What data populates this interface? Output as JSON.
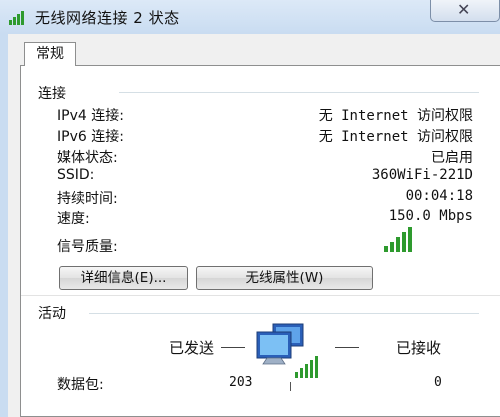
{
  "window": {
    "title": "无线网络连接 2 状态",
    "close_glyph": "✕"
  },
  "tabs": [
    {
      "label": "常规"
    }
  ],
  "connection": {
    "group_label": "连接",
    "rows": [
      {
        "label": "IPv4 连接:",
        "value": "无 Internet 访问权限"
      },
      {
        "label": "IPv6 连接:",
        "value": "无 Internet 访问权限"
      },
      {
        "label": "媒体状态:",
        "value": "已启用"
      },
      {
        "label": "SSID:",
        "value": "360WiFi-221D"
      },
      {
        "label": "持续时间:",
        "value": "00:04:18"
      },
      {
        "label": "速度:",
        "value": "150.0 Mbps"
      }
    ],
    "signal_label": "信号质量:",
    "signal_icon": "signal-bars-icon",
    "signal_level": 1.0,
    "details_button": "详细信息(E)...",
    "properties_button": "无线属性(W)"
  },
  "activity": {
    "group_label": "活动",
    "sent_label": "已发送",
    "received_label": "已接收",
    "packets_label": "数据包:",
    "packets_sent": "203",
    "packets_received": "0",
    "icon": "network-computers-icon"
  },
  "colors": {
    "signal_green": "#2e9a2e",
    "titlebar": "#dce9f7",
    "panel_bg": "#ffffff"
  }
}
